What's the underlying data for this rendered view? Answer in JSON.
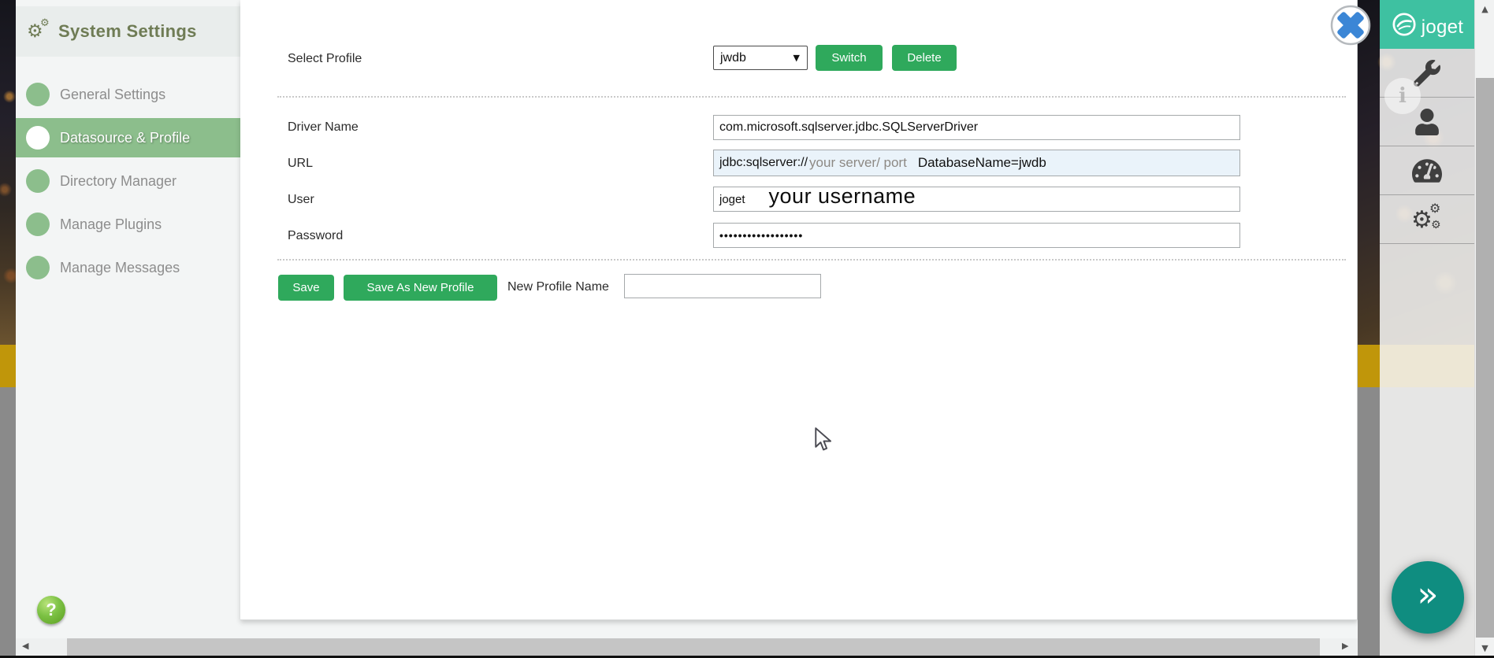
{
  "sidebar": {
    "title": "System Settings",
    "items": [
      {
        "label": "General Settings"
      },
      {
        "label": "Datasource & Profile"
      },
      {
        "label": "Directory Manager"
      },
      {
        "label": "Manage Plugins"
      },
      {
        "label": "Manage Messages"
      }
    ]
  },
  "form": {
    "profile": {
      "label": "Select Profile",
      "value": "jwdb",
      "switch": "Switch",
      "delete": "Delete"
    },
    "driver": {
      "label": "Driver Name",
      "value": "com.microsoft.sqlserver.jdbc.SQLServerDriver"
    },
    "url": {
      "label": "URL",
      "prefix": "jdbc:sqlserver://",
      "annotation": "your server/ port",
      "suffix": "DatabaseName=jwdb"
    },
    "user": {
      "label": "User",
      "value": "joget",
      "annotation": "your username"
    },
    "password": {
      "label": "Password",
      "value": "••••••••••••••••••"
    },
    "actions": {
      "save": "Save",
      "save_as": "Save As New Profile",
      "new_profile_label": "New Profile Name",
      "new_profile_value": ""
    }
  },
  "rightbar": {
    "brand": "joget",
    "icons": [
      "wrench-icon",
      "user-icon",
      "dashboard-icon",
      "gears-icon"
    ]
  },
  "glyphs": {
    "gear": "⚙",
    "select_caret": "▼",
    "scroll_up": "▲",
    "scroll_down": "▼",
    "scroll_left": "◀",
    "scroll_right": "▶",
    "expand": "»",
    "help": "?",
    "info": "i"
  },
  "colors": {
    "button_green": "#2fa95c",
    "active_item_green": "#8cbe8c",
    "brand_teal": "#3ec1a1",
    "fab_teal": "#0f8d80",
    "title_olive": "#6f7c55",
    "close_x_blue": "#3b86d6",
    "url_field_bg": "#eaf3fa",
    "yellow_band": "#c0960a"
  }
}
